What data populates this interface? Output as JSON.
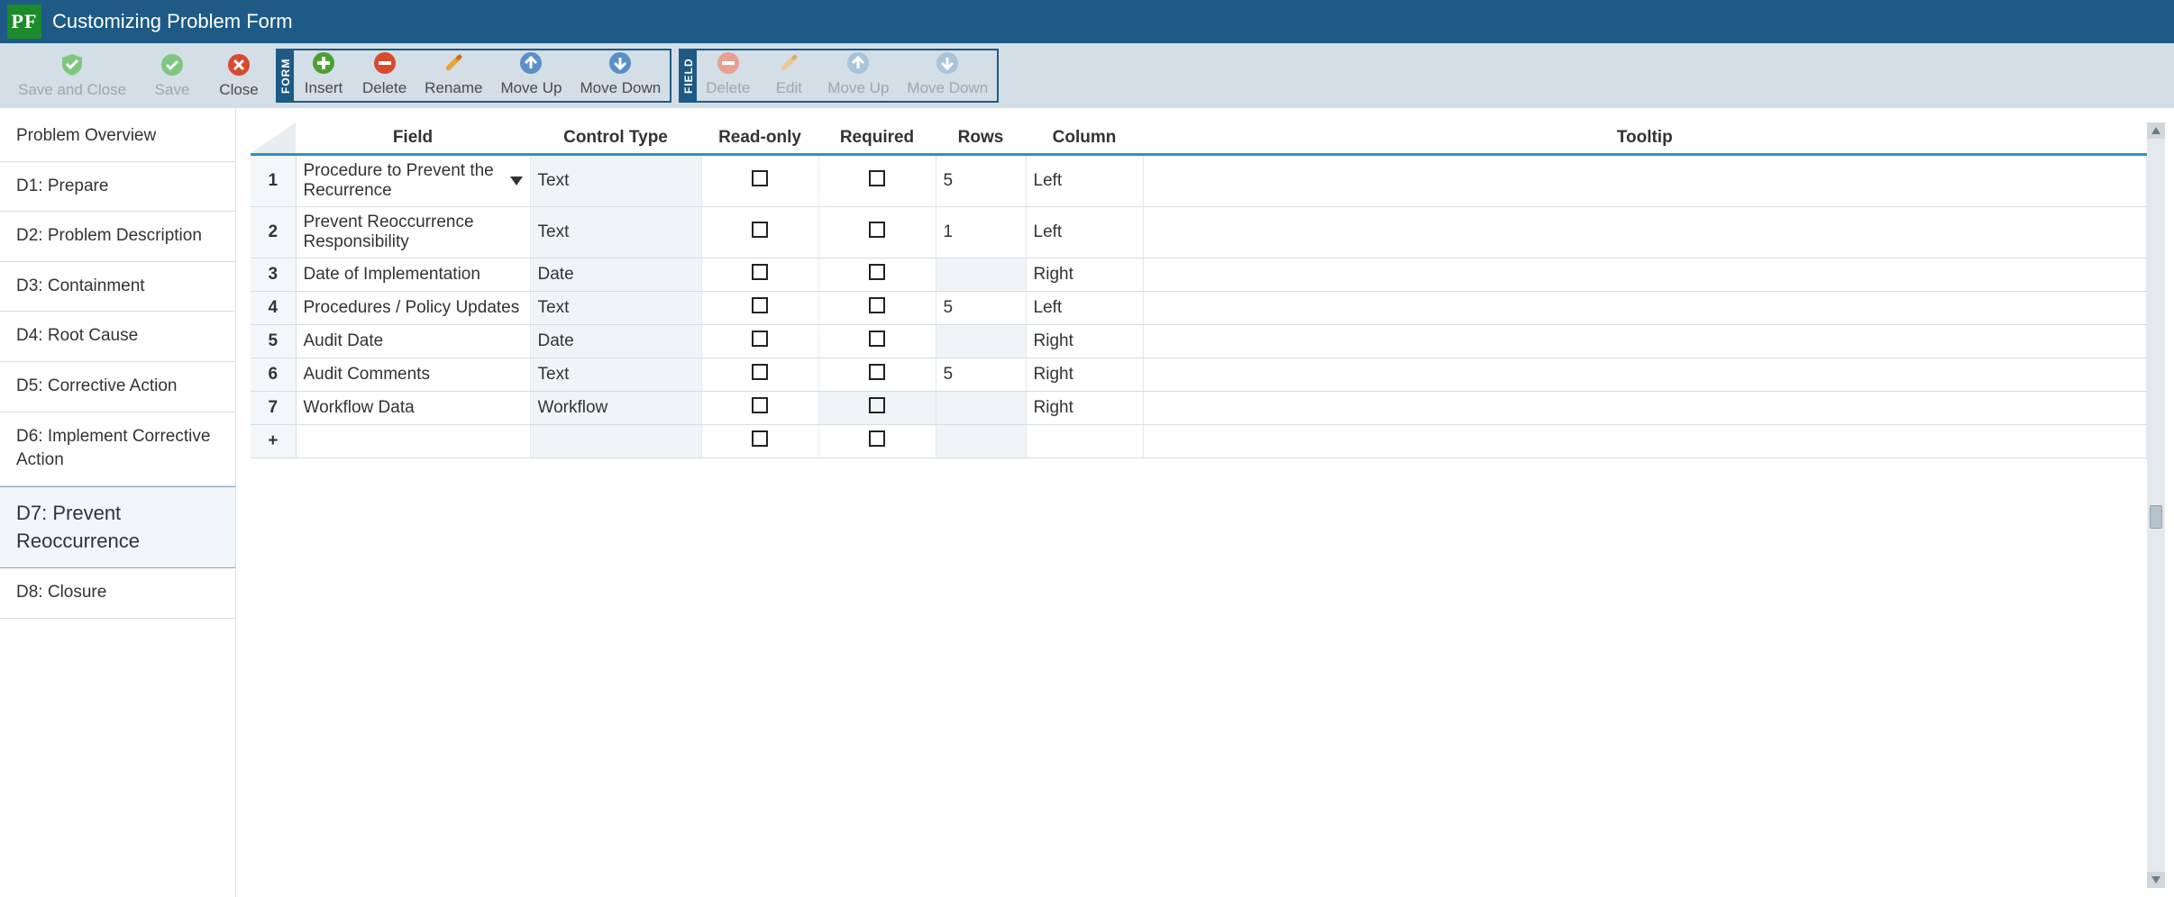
{
  "app": {
    "logo_text": "PF",
    "title": "Customizing Problem Form"
  },
  "toolbar": {
    "save_close": "Save and Close",
    "save": "Save",
    "close": "Close",
    "form_group": "FORM",
    "form_insert": "Insert",
    "form_delete": "Delete",
    "form_rename": "Rename",
    "form_move_up": "Move Up",
    "form_move_down": "Move Down",
    "field_group": "FIELD",
    "field_delete": "Delete",
    "field_edit": "Edit",
    "field_move_up": "Move Up",
    "field_move_down": "Move Down"
  },
  "sidebar": {
    "items": [
      {
        "label": "Problem Overview"
      },
      {
        "label": "D1: Prepare"
      },
      {
        "label": "D2: Problem Description"
      },
      {
        "label": "D3: Containment"
      },
      {
        "label": "D4: Root Cause"
      },
      {
        "label": "D5: Corrective Action"
      },
      {
        "label": "D6: Implement Corrective Action"
      },
      {
        "label": "D7: Prevent Reoccurrence"
      },
      {
        "label": "D8: Closure"
      }
    ],
    "active_index": 7
  },
  "grid": {
    "headers": {
      "field": "Field",
      "control_type": "Control Type",
      "read_only": "Read-only",
      "required": "Required",
      "rows": "Rows",
      "column": "Column",
      "tooltip": "Tooltip"
    },
    "rows": [
      {
        "n": "1",
        "field": "Procedure to Prevent the Recurrence",
        "has_dd": true,
        "ctrl": "Text",
        "ro": false,
        "req": false,
        "rows": "5",
        "col": "Left",
        "tip": "",
        "shadeField": false,
        "shadeCtrl": true,
        "shadeReq": false,
        "shadeRows": false
      },
      {
        "n": "2",
        "field": "Prevent Reoccurrence Responsibility",
        "has_dd": false,
        "ctrl": "Text",
        "ro": false,
        "req": false,
        "rows": "1",
        "col": "Left",
        "tip": "",
        "shadeField": false,
        "shadeCtrl": true,
        "shadeReq": false,
        "shadeRows": false
      },
      {
        "n": "3",
        "field": "Date of Implementation",
        "has_dd": false,
        "ctrl": "Date",
        "ro": false,
        "req": false,
        "rows": "",
        "col": "Right",
        "tip": "",
        "shadeField": false,
        "shadeCtrl": true,
        "shadeReq": false,
        "shadeRows": true
      },
      {
        "n": "4",
        "field": "Procedures / Policy Updates",
        "has_dd": false,
        "ctrl": "Text",
        "ro": false,
        "req": false,
        "rows": "5",
        "col": "Left",
        "tip": "",
        "shadeField": false,
        "shadeCtrl": true,
        "shadeReq": false,
        "shadeRows": false
      },
      {
        "n": "5",
        "field": "Audit Date",
        "has_dd": false,
        "ctrl": "Date",
        "ro": false,
        "req": false,
        "rows": "",
        "col": "Right",
        "tip": "",
        "shadeField": false,
        "shadeCtrl": true,
        "shadeReq": false,
        "shadeRows": true
      },
      {
        "n": "6",
        "field": "Audit Comments",
        "has_dd": false,
        "ctrl": "Text",
        "ro": false,
        "req": false,
        "rows": "5",
        "col": "Right",
        "tip": "",
        "shadeField": false,
        "shadeCtrl": true,
        "shadeReq": false,
        "shadeRows": false
      },
      {
        "n": "7",
        "field": "Workflow Data",
        "has_dd": false,
        "ctrl": "Workflow",
        "ro": false,
        "req": false,
        "rows": "",
        "col": "Right",
        "tip": "",
        "shadeField": false,
        "shadeCtrl": true,
        "shadeReq": true,
        "shadeRows": true
      }
    ],
    "add_row_marker": "+"
  }
}
